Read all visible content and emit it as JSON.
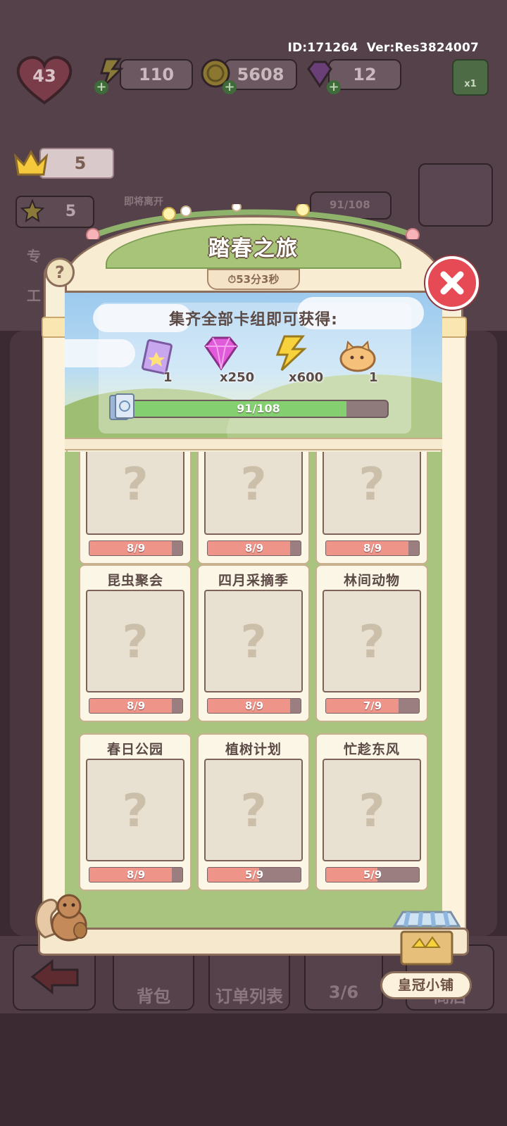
{
  "header": {
    "id_text": "ID:171264",
    "version_text": "Ver:Res3824007",
    "level": "43",
    "energy": "110",
    "coins": "5608",
    "gems": "12",
    "boost_label": "x1",
    "crowns": "5",
    "stars": "5"
  },
  "background": {
    "upcoming_label": "即将离开",
    "bg_progress": "91/108",
    "side_label_1": "专",
    "side_label_2": "工"
  },
  "bottom_bar": {
    "bag_label": "背包",
    "orders_label": "订单列表",
    "cars_count": "3/6",
    "shop_label": "商店"
  },
  "event": {
    "title": "踏春之旅",
    "timer": "53分3秒",
    "reward_title": "集齐全部卡组即可获得:",
    "rewards": [
      {
        "icon": "card-pack-icon",
        "amount": "1"
      },
      {
        "icon": "gem-icon",
        "amount": "x250"
      },
      {
        "icon": "energy-icon",
        "amount": "x600"
      },
      {
        "icon": "cat-pet-icon",
        "amount": "1"
      }
    ],
    "progress_text": "91/108",
    "progress_fraction": 0.8426,
    "help_label": "?",
    "shop_button": "皇冠小铺"
  },
  "decks": [
    {
      "title": "",
      "progress": "8/9",
      "fraction": 0.889
    },
    {
      "title": "",
      "progress": "8/9",
      "fraction": 0.889
    },
    {
      "title": "",
      "progress": "8/9",
      "fraction": 0.889
    },
    {
      "title": "昆虫聚会",
      "progress": "8/9",
      "fraction": 0.889
    },
    {
      "title": "四月采摘季",
      "progress": "8/9",
      "fraction": 0.889
    },
    {
      "title": "林间动物",
      "progress": "7/9",
      "fraction": 0.778
    },
    {
      "title": "春日公园",
      "progress": "8/9",
      "fraction": 0.889
    },
    {
      "title": "植树计划",
      "progress": "5/9",
      "fraction": 0.556
    },
    {
      "title": "忙趁东风",
      "progress": "5/9",
      "fraction": 0.556
    }
  ],
  "colors": {
    "accent_green": "#a8c478",
    "progress_green": "#84cf6f",
    "deck_bar_fill": "#ef9488",
    "close_red": "#e64b55"
  }
}
